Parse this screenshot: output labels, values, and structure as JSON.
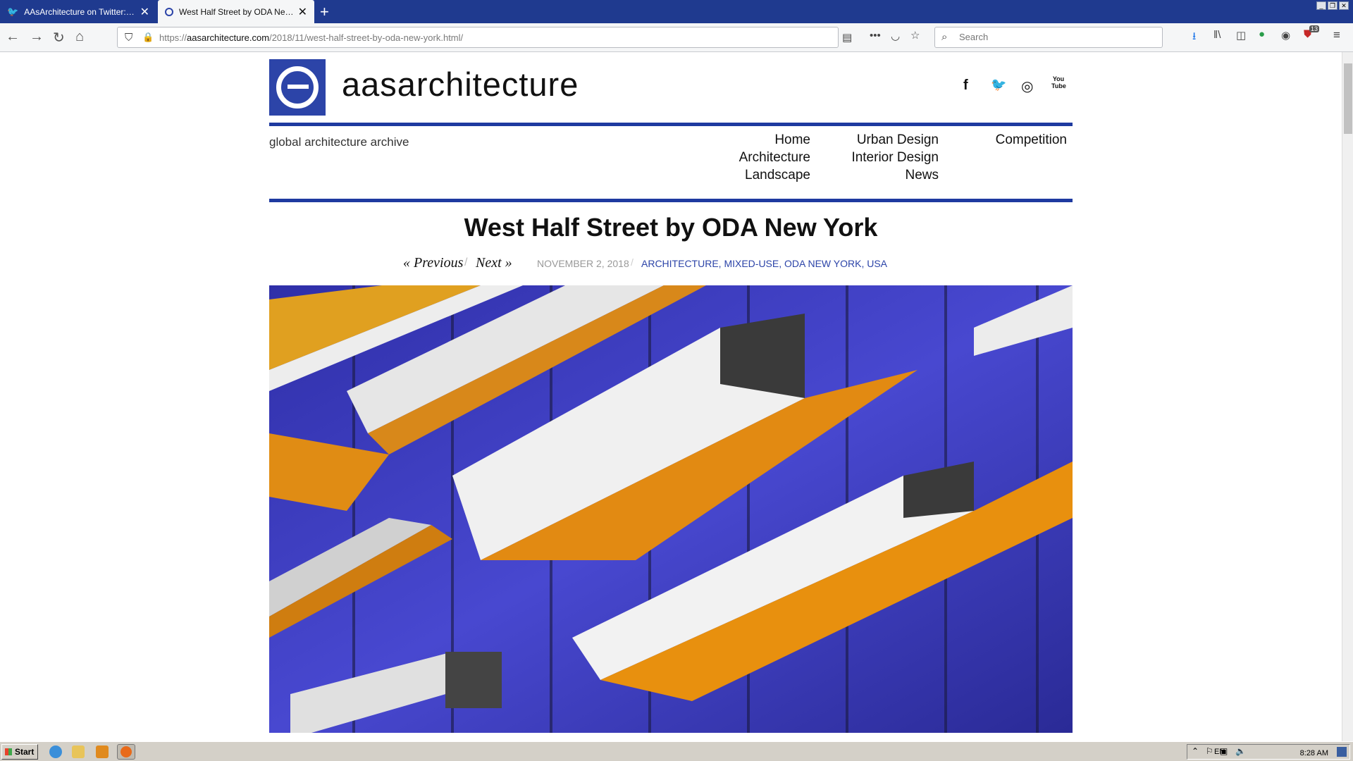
{
  "browser": {
    "tabs": [
      {
        "title": "AAsArchitecture on Twitter: \"West Half Street by ODA New York",
        "close": "✕"
      },
      {
        "title": "West Half Street by ODA New York",
        "close": "✕"
      }
    ],
    "new_tab": "+",
    "url_prefix": "https://",
    "url_domain": "aasarchitecture.com",
    "url_path": "/2018/11/west-half-street-by-oda-new-york.html/",
    "search_placeholder": "Search",
    "badge_count": "13"
  },
  "site": {
    "name": "aasarchitecture",
    "tagline": "global architecture archive",
    "social": [
      "f",
      "🐦",
      "◎",
      "You Tube"
    ],
    "nav": {
      "col1": [
        "Home",
        "Architecture",
        "Landscape"
      ],
      "col2": [
        "Urban Design",
        "Interior Design",
        "News"
      ],
      "col3": [
        "Competition"
      ]
    }
  },
  "article": {
    "title": "West Half Street by ODA New York",
    "previous": "« Previous",
    "next": "Next »",
    "date": "NOVEMBER 2, 2018",
    "categories": "ARCHITECTURE, MIXED-USE, ODA NEW YORK, USA"
  },
  "taskbar": {
    "start": "Start",
    "lang": "EN",
    "time": "8:28 AM"
  },
  "colors": {
    "brand": "#2c44a8",
    "tabbar": "#1f3a8f",
    "glass": "#3a3ab8",
    "accent_orange": "#e28a12"
  }
}
